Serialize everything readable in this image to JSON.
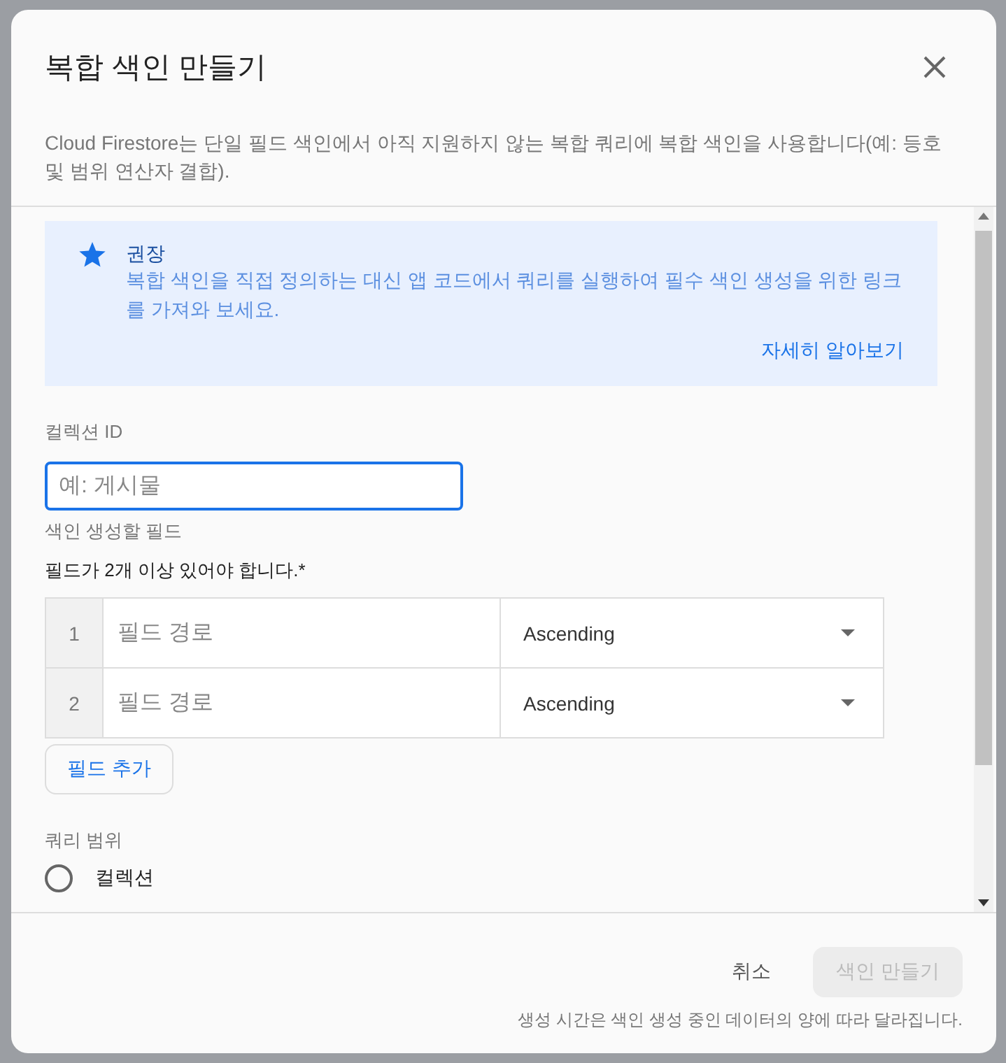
{
  "dialog": {
    "title": "복합 색인 만들기",
    "description": "Cloud Firestore는 단일 필드 색인에서 아직 지원하지 않는 복합 쿼리에 복합 색인을 사용합니다(예: 등호 및 범위 연산자 결합)."
  },
  "recommendation": {
    "title": "권장",
    "body": "복합 색인을 직접 정의하는 대신 앱 코드에서 쿼리를 실행하여 필수 색인 생성을 위한 링크를 가져와 보세요.",
    "link": "자세히 알아보기"
  },
  "collection_id": {
    "label": "컬렉션 ID",
    "placeholder": "예: 게시물"
  },
  "fields_label": "색인 생성할 필드",
  "fields_note": "필드가 2개 이상 있어야 합니다.*",
  "fields": [
    {
      "number": "1",
      "placeholder": "필드 경로",
      "order": "Ascending"
    },
    {
      "number": "2",
      "placeholder": "필드 경로",
      "order": "Ascending"
    }
  ],
  "add_field": "필드 추가",
  "query_scope": {
    "label": "쿼리 범위",
    "options": [
      {
        "label": "컬렉션",
        "selected": false
      }
    ]
  },
  "footer": {
    "cancel": "취소",
    "create": "색인 만들기",
    "create_disabled": true,
    "note": "생성 시간은 색인 생성 중인 데이터의 양에 따라 달라집니다."
  }
}
